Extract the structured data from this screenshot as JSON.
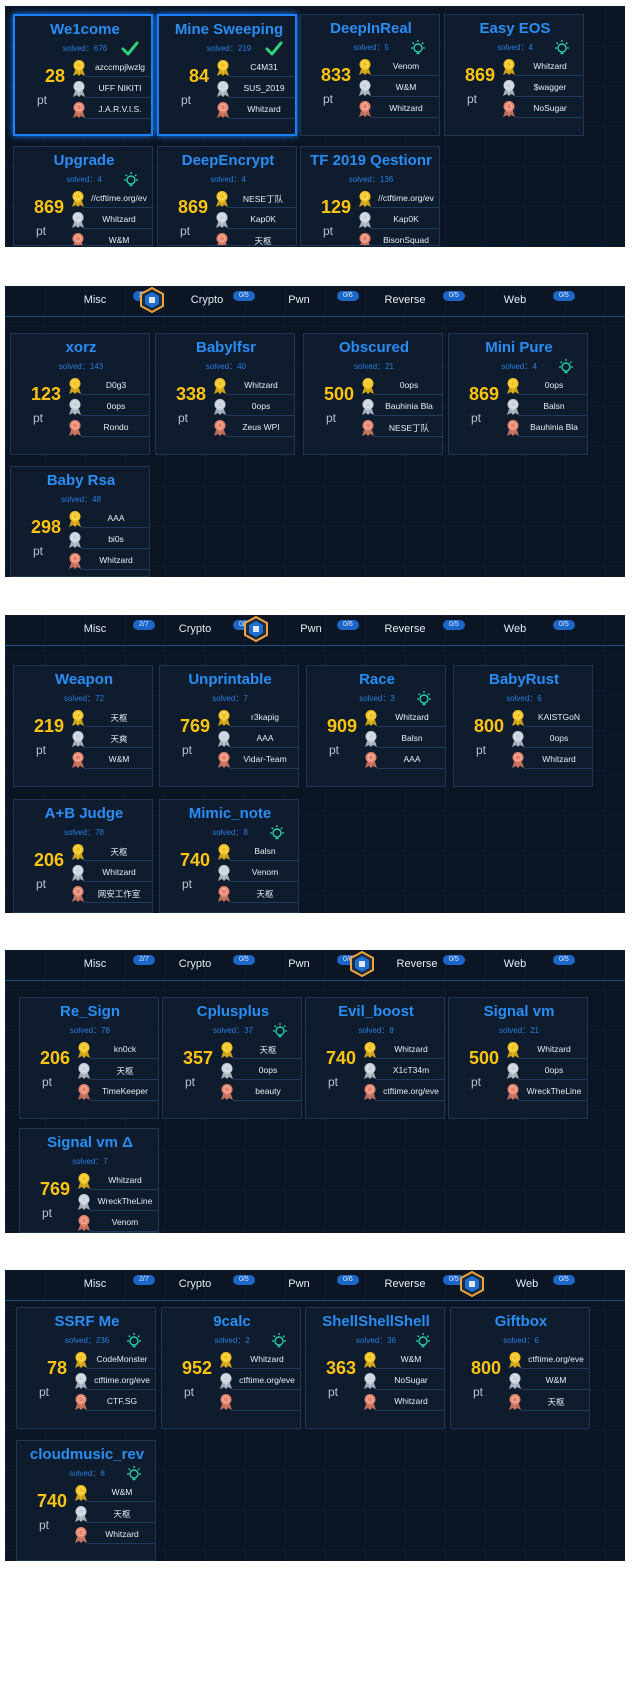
{
  "tabs": [
    {
      "label": "Misc",
      "count": "2/7"
    },
    {
      "label": "Crypto",
      "count": "0/5"
    },
    {
      "label": "Pwn",
      "count": "0/6"
    },
    {
      "label": "Reverse",
      "count": "0/5"
    },
    {
      "label": "Web",
      "count": "0/5"
    }
  ],
  "pt_label": "pt",
  "colors": {
    "accent": "#2a8df4",
    "points": "#ffc410",
    "solved_check": "#2fd17a",
    "hint_bulb": "#2ad1a8",
    "selected_border": "#1a80ff"
  },
  "sections": [
    {
      "has_tabbar": false,
      "cards": [
        {
          "title": "We1come",
          "solved": "solved：676",
          "points": "28",
          "mark": "check",
          "selected": true,
          "ranks": [
            "azccmpjlwzlg",
            "UFF NIKITI",
            "J.A.R.V.I.S."
          ]
        },
        {
          "title": "Mine Sweeping",
          "solved": "solved：219",
          "points": "84",
          "mark": "check",
          "selected": true,
          "ranks": [
            "C4M31",
            "SUS_2019",
            "Whitzard"
          ]
        },
        {
          "title": "DeepInReal",
          "solved": "solved：5",
          "points": "833",
          "mark": "bulb",
          "ranks": [
            "Venom",
            "W&M",
            "Whitzard"
          ]
        },
        {
          "title": "Easy EOS",
          "solved": "solved：4",
          "points": "869",
          "mark": "bulb",
          "ranks": [
            "Whitzard",
            "$wagger",
            "NoSugar"
          ]
        },
        {
          "title": "Upgrade",
          "solved": "solved：4",
          "points": "869",
          "mark": "bulb",
          "ranks": [
            "//ctftime.org/ev",
            "Whitzard",
            "W&M"
          ]
        },
        {
          "title": "DeepEncrypt",
          "solved": "solved：4",
          "points": "869",
          "mark": "",
          "ranks": [
            "NESE丁队",
            "Kap0K",
            "天枢"
          ]
        },
        {
          "title": "TF 2019 Qestionr",
          "solved": "solved：136",
          "points": "129",
          "mark": "",
          "ranks": [
            "//ctftime.org/ev",
            "Kap0K",
            "BisonSquad"
          ]
        }
      ]
    },
    {
      "has_tabbar": true,
      "active_tab": 1,
      "cards": [
        {
          "title": "xorz",
          "solved": "solved：143",
          "points": "123",
          "mark": "",
          "ranks": [
            "D0g3",
            "0ops",
            "Rondo"
          ]
        },
        {
          "title": "Babylfsr",
          "solved": "solved：40",
          "points": "338",
          "mark": "",
          "ranks": [
            "Whitzard",
            "0ops",
            "Zeus WPI"
          ]
        },
        {
          "title": "Obscured",
          "solved": "solved：21",
          "points": "500",
          "mark": "",
          "ranks": [
            "0ops",
            "Bauhinia   Bla",
            "NESE丁队"
          ]
        },
        {
          "title": "Mini Pure",
          "solved": "solved：4",
          "points": "869",
          "mark": "bulb",
          "ranks": [
            "0ops",
            "Balsn",
            "Bauhinia   Bla"
          ]
        },
        {
          "title": "Baby Rsa",
          "solved": "solved：48",
          "points": "298",
          "mark": "",
          "ranks": [
            "AAA",
            "bi0s",
            "Whitzard"
          ]
        }
      ]
    },
    {
      "has_tabbar": true,
      "active_tab": 2,
      "cards": [
        {
          "title": "Weapon",
          "solved": "solved：72",
          "points": "219",
          "mark": "",
          "ranks": [
            "天枢",
            "天爽",
            "W&M"
          ]
        },
        {
          "title": "Unprintable",
          "solved": "solved：7",
          "points": "769",
          "mark": "",
          "ranks": [
            "r3kapig",
            "AAA",
            "Vidar-Team"
          ]
        },
        {
          "title": "Race",
          "solved": "solved：3",
          "points": "909",
          "mark": "bulb",
          "ranks": [
            "Whitzard",
            "Balsn",
            "AAA"
          ]
        },
        {
          "title": "BabyRust",
          "solved": "solved：6",
          "points": "800",
          "mark": "",
          "ranks": [
            "KAISTGoN",
            "0ops",
            "Whitzard"
          ]
        },
        {
          "title": "A+B Judge",
          "solved": "solved：78",
          "points": "206",
          "mark": "",
          "ranks": [
            "天枢",
            "Whitzard",
            "网安工作室"
          ]
        },
        {
          "title": "Mimic_note",
          "solved": "solved：8",
          "points": "740",
          "mark": "bulb",
          "ranks": [
            "Balsn",
            "Venom",
            "天枢"
          ]
        }
      ]
    },
    {
      "has_tabbar": true,
      "active_tab": 3,
      "cards": [
        {
          "title": "Re_Sign",
          "solved": "solved：78",
          "points": "206",
          "mark": "",
          "ranks": [
            "kn0ck",
            "天枢",
            "TimeKeeper"
          ]
        },
        {
          "title": "Cplusplus",
          "solved": "solved：37",
          "points": "357",
          "mark": "bulb",
          "ranks": [
            "天枢",
            "0ops",
            "beauty"
          ]
        },
        {
          "title": "Evil_boost",
          "solved": "solved：8",
          "points": "740",
          "mark": "",
          "ranks": [
            "Whitzard",
            "X1cT34m",
            "ctftime.org/eve"
          ]
        },
        {
          "title": "Signal vm",
          "solved": "solved：21",
          "points": "500",
          "mark": "",
          "ranks": [
            "Whitzard",
            "0ops",
            "WreckTheLine"
          ]
        },
        {
          "title": "Signal vm Δ",
          "solved": "solved：7",
          "points": "769",
          "mark": "",
          "ranks": [
            "Whitzard",
            "WreckTheLine",
            "Venom"
          ]
        }
      ]
    },
    {
      "has_tabbar": true,
      "active_tab": 4,
      "cards": [
        {
          "title": "SSRF Me",
          "solved": "solved：236",
          "points": "78",
          "mark": "bulb",
          "ranks": [
            "CodeMonster",
            "ctftime.org/eve",
            "CTF.SG"
          ]
        },
        {
          "title": "9calc",
          "solved": "solved：2",
          "points": "952",
          "mark": "bulb",
          "ranks": [
            "Whitzard",
            "ctftime.org/eve",
            ""
          ]
        },
        {
          "title": "ShellShellShell",
          "solved": "solved：36",
          "points": "363",
          "mark": "bulb",
          "ranks": [
            "W&M",
            "NoSugar",
            "Whitzard"
          ]
        },
        {
          "title": "Giftbox",
          "solved": "solved：6",
          "points": "800",
          "mark": "",
          "ranks": [
            "ctftime.org/eve",
            "W&M",
            "天枢"
          ]
        },
        {
          "title": "cloudmusic_rev",
          "solved": "solved：8",
          "points": "740",
          "mark": "bulb",
          "ranks": [
            "W&M",
            "天枢",
            "Whitzard"
          ]
        }
      ]
    }
  ]
}
